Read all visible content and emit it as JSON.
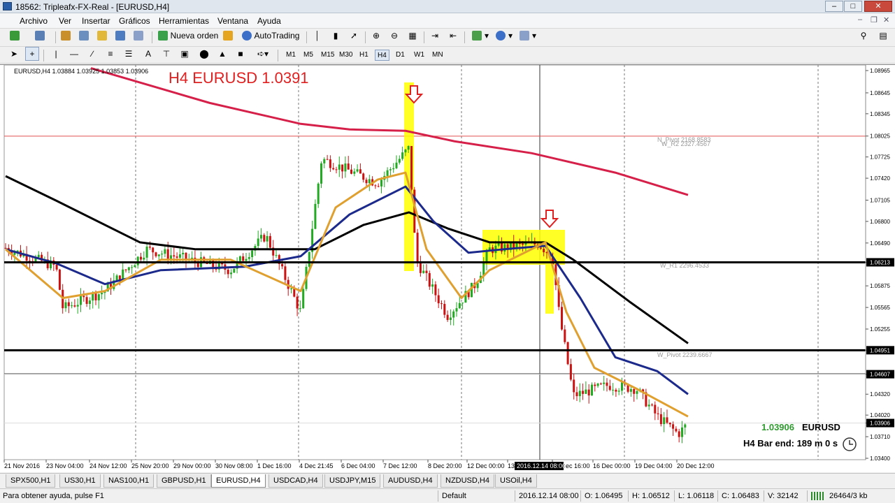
{
  "window": {
    "title": "18562: Tripleafx-FX-Real - [EURUSD,H4]",
    "min": "–",
    "max": "□",
    "close": "✕"
  },
  "menu": [
    "Archivo",
    "Ver",
    "Insertar",
    "Gráficos",
    "Herramientas",
    "Ventana",
    "Ayuda"
  ],
  "toolbar": {
    "new_order": "Nueva orden",
    "autotrading": "AutoTrading"
  },
  "timeframes": [
    "M1",
    "M5",
    "M15",
    "M30",
    "H1",
    "H4",
    "D1",
    "W1",
    "MN"
  ],
  "active_timeframe": "H4",
  "chart": {
    "header": "EURUSD,H4  1.03884 1.03925 1.03853 1.03906",
    "annotation": "H4 EURUSD 1.0391",
    "price_ticks": [
      "1.08965",
      "1.08645",
      "1.08345",
      "1.08025",
      "1.07725",
      "1.07420",
      "1.07105",
      "1.06800",
      "1.06490",
      "1.06213",
      "1.05875",
      "1.05565",
      "1.05255",
      "1.04951",
      "1.04607",
      "1.04320",
      "1.04020",
      "1.03906",
      "1.03710",
      "1.03400"
    ],
    "time_ticks": [
      "21 Nov 2016",
      "23 Nov 04:00",
      "24 Nov 12:00",
      "25 Nov 20:00",
      "29 Nov 00:00",
      "30 Nov 08:00",
      "1 Dec 16:00",
      "4 Dec 21:45",
      "6 Dec 04:00",
      "7 Dec 12:00",
      "8 Dec 20:00",
      "12 Dec 00:00",
      "13 Dec 08:00",
      "14 Dec 16:00",
      "16 Dec 00:00",
      "19 Dec 04:00",
      "20 Dec 12:00"
    ],
    "crosshair_time": "2016.12.14 08:00",
    "pivot_labels": [
      "N_Pivot 2168.8583",
      "W_R2 2327.4567",
      "W_R1 2296.4533",
      "W_Pivot 2239.6667"
    ],
    "levels_highlight": {
      "resistance": "1.06213",
      "support": "1.04951",
      "pivot": "1.04607",
      "current": "1.03906",
      "r2": "1.08024"
    },
    "info_price": "1.03906",
    "info_symbol": "EURUSD",
    "bar_end": "H4 Bar end: 189 m 0 s"
  },
  "colors": {
    "ema_fast": "#e0a030",
    "ema_mid": "#1c2a8c",
    "ema_slow": "#000000",
    "ema_long": "#d6204a",
    "bull": "#22aa22",
    "bear": "#cc1111",
    "highlight": "#ffff00",
    "arrow": "#e02020"
  },
  "tabs": [
    "SPX500,H1",
    "US30,H1",
    "NAS100,H1",
    "GBPUSD,H1",
    "EURUSD,H4",
    "USDCAD,H4",
    "USDJPY,M15",
    "AUDUSD,H4",
    "NZDUSD,H4",
    "USOil,H4"
  ],
  "active_tab": "EURUSD,H4",
  "status": {
    "help": "Para obtener ayuda, pulse F1",
    "profile": "Default",
    "time": "2016.12.14 08:00",
    "open": "O: 1.06495",
    "high": "H: 1.06512",
    "low": "L: 1.06118",
    "close": "C: 1.06483",
    "volume": "V: 32142",
    "traffic": "26464/3 kb"
  }
}
